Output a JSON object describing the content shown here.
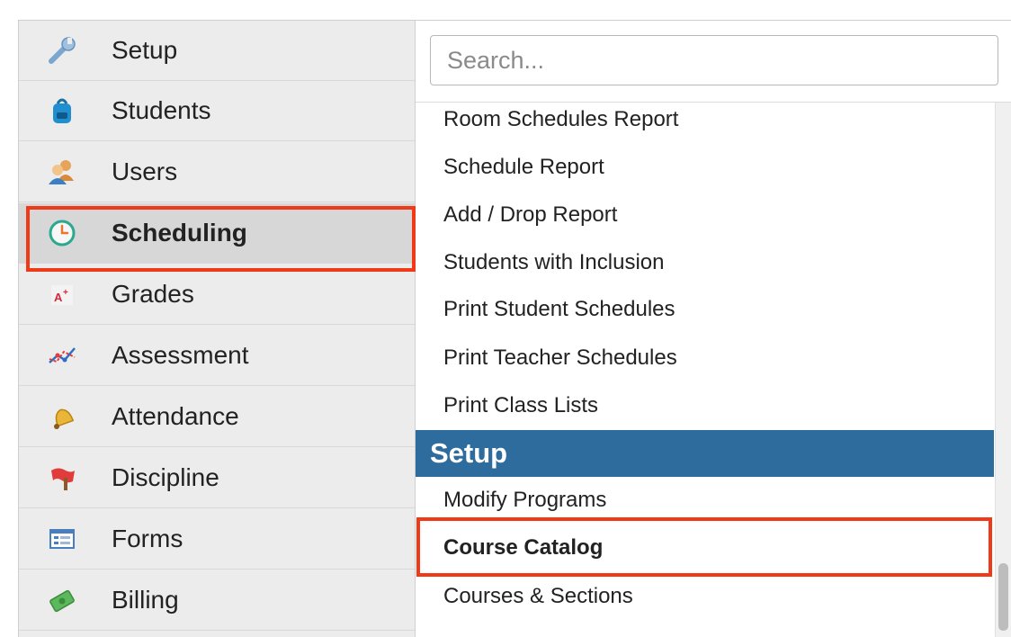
{
  "sidebar": {
    "items": [
      {
        "label": "Setup",
        "icon": "wrench-icon"
      },
      {
        "label": "Students",
        "icon": "backpack-icon"
      },
      {
        "label": "Users",
        "icon": "users-icon"
      },
      {
        "label": "Scheduling",
        "icon": "clock-icon",
        "active": true
      },
      {
        "label": "Grades",
        "icon": "grade-icon"
      },
      {
        "label": "Assessment",
        "icon": "chart-line-icon"
      },
      {
        "label": "Attendance",
        "icon": "bell-icon"
      },
      {
        "label": "Discipline",
        "icon": "flag-icon"
      },
      {
        "label": "Forms",
        "icon": "form-icon"
      },
      {
        "label": "Billing",
        "icon": "money-icon"
      }
    ]
  },
  "search": {
    "placeholder": "Search..."
  },
  "menu": {
    "reports": [
      "Room Schedules Report",
      "Schedule Report",
      "Add / Drop Report",
      "Students with Inclusion",
      "Print Student Schedules",
      "Print Teacher Schedules",
      "Print Class Lists"
    ],
    "section_title": "Setup",
    "setup_items": [
      "Modify Programs",
      "Course Catalog",
      "Courses & Sections"
    ]
  },
  "colors": {
    "highlight": "#f03a17",
    "section_header": "#2e6c9e",
    "sidebar_bg": "#ececec",
    "sidebar_active": "#d7d7d7"
  }
}
